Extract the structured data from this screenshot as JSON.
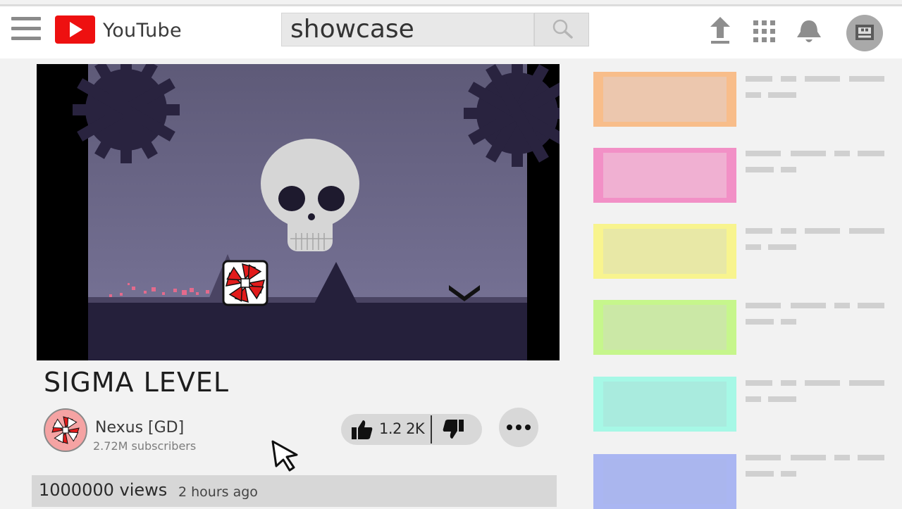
{
  "header": {
    "brand": "YouTube",
    "search_query": "showcase"
  },
  "video": {
    "title": "SIGMA LEVEL",
    "channel_name": "Nexus [GD]",
    "subscribers": "2.72M subscribers",
    "likes": "1.2 2K",
    "views": "1000000 views",
    "posted": "2 hours ago"
  },
  "sidebar": {
    "recommendations": [
      {
        "border": "#f8bd8a",
        "fill": "#ecc7ae"
      },
      {
        "border": "#f290c6",
        "fill": "#f0b0d2"
      },
      {
        "border": "#f8f48e",
        "fill": "#e8e8a6"
      },
      {
        "border": "#c6f68c",
        "fill": "#cbe8a6"
      },
      {
        "border": "#a6f8e6",
        "fill": "#a9ebde"
      },
      {
        "border": "#aab6f2",
        "fill": "#aab6ee"
      }
    ]
  },
  "colors": {
    "logo_red": "#ee1010",
    "scene_sky": "#6c6887",
    "scene_ground": "#25203b"
  },
  "icons": [
    "menu-icon",
    "play-logo-icon",
    "search-icon",
    "upload-icon",
    "apps-icon",
    "bell-icon",
    "account-icon",
    "thumbs-up-icon",
    "thumbs-down-icon",
    "more-dots-icon",
    "cursor-pointer-icon"
  ]
}
